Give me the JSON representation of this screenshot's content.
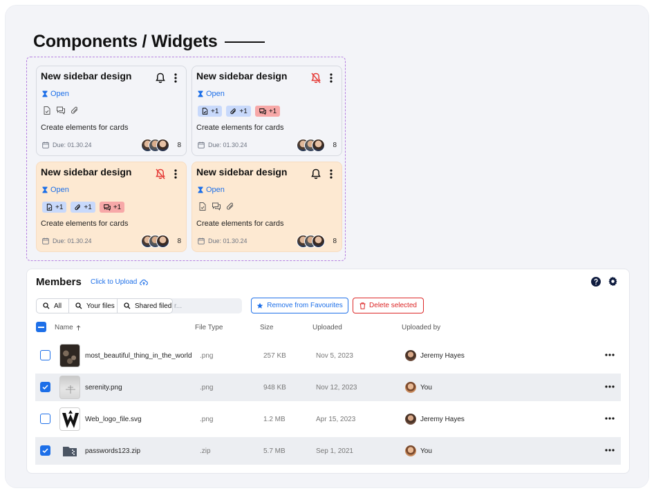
{
  "page_title": "Components / Widgets",
  "cards": [
    {
      "title": "New sidebar design",
      "bell": "bell-icon",
      "status": "Open",
      "pills": [],
      "desc": "Create elements for cards",
      "due": "Due: 01.30.24",
      "count": "8"
    },
    {
      "title": "New sidebar design",
      "bell": "bell-off-icon",
      "status": "Open",
      "pills": [
        "+1",
        "+1",
        "+1"
      ],
      "desc": "Create elements for cards",
      "due": "Due: 01.30.24",
      "count": "8"
    },
    {
      "title": "New sidebar design",
      "bell": "bell-off-icon",
      "status": "Open",
      "pills": [
        "+1",
        "+1",
        "+1"
      ],
      "desc": "Create elements for cards",
      "due": "Due: 01.30.24",
      "count": "8"
    },
    {
      "title": "New sidebar design",
      "bell": "bell-icon",
      "status": "Open",
      "pills": [],
      "desc": "Create elements for cards",
      "due": "Due: 01.30.24",
      "count": "8"
    }
  ],
  "members": {
    "title": "Members",
    "upload_link": "Click to Upload",
    "filters": {
      "all": "All",
      "your_files": "Your files",
      "shared": "Shared filed"
    },
    "search_placeholder": "r...",
    "btn_fav": "Remove from Favourites",
    "btn_del": "Delete selected",
    "columns": {
      "name": "Name",
      "type": "File Type",
      "size": "Size",
      "uploaded": "Uploaded",
      "uploaded_by": "Uploaded by"
    },
    "rows": [
      {
        "name": "most_beautiful_thing_in_the_world....",
        "type": ".png",
        "size": "257 KB",
        "date": "Nov 5, 2023",
        "user": "Jeremy Hayes",
        "checked": false
      },
      {
        "name": "serenity.png",
        "type": ".png",
        "size": "948 KB",
        "date": "Nov 12, 2023",
        "user": "You",
        "checked": true
      },
      {
        "name": "Web_logo_file.svg",
        "type": ".png",
        "size": "1.2 MB",
        "date": "Apr 15, 2023",
        "user": "Jeremy Hayes",
        "checked": false
      },
      {
        "name": "passwords123.zip",
        "type": ".zip",
        "size": "5.7 MB",
        "date": "Sep 1, 2021",
        "user": "You",
        "checked": true
      }
    ]
  },
  "colors": {
    "accent": "#1d6fe8",
    "danger": "#dc2626",
    "peach": "#fde9d2",
    "dashed": "#b57ee0"
  }
}
